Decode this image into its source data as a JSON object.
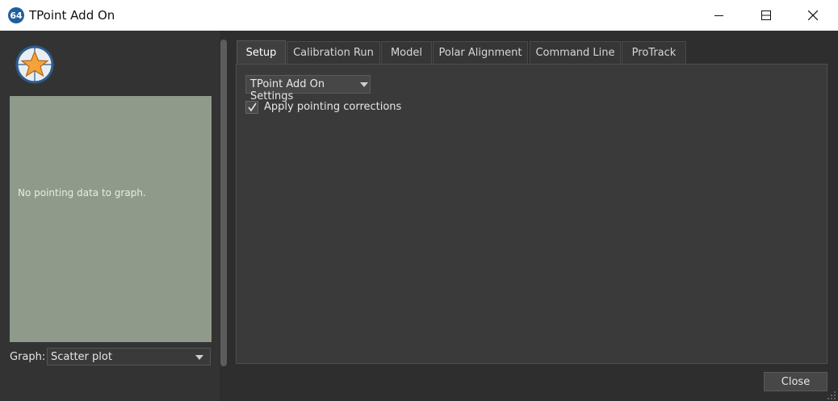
{
  "window": {
    "title": "TPoint Add On",
    "app_icon_text": "64"
  },
  "left_pane": {
    "graph_message": "No pointing data to graph.",
    "graph_label": "Graph:",
    "graph_selected": "Scatter plot"
  },
  "tabs": [
    {
      "label": "Setup",
      "active": true
    },
    {
      "label": "Calibration Run",
      "active": false
    },
    {
      "label": "Model",
      "active": false
    },
    {
      "label": "Polar Alignment",
      "active": false
    },
    {
      "label": "Command Line",
      "active": false
    },
    {
      "label": "ProTrack",
      "active": false
    }
  ],
  "setup": {
    "settings_button": "TPoint Add On Settings",
    "apply_corrections_label": "Apply pointing corrections",
    "apply_corrections_checked": true
  },
  "footer": {
    "close_label": "Close"
  },
  "colors": {
    "graph_bg": "#8f9a8b",
    "panel_bg": "#3a3a3a",
    "app_icon": "#1f5f9e"
  }
}
